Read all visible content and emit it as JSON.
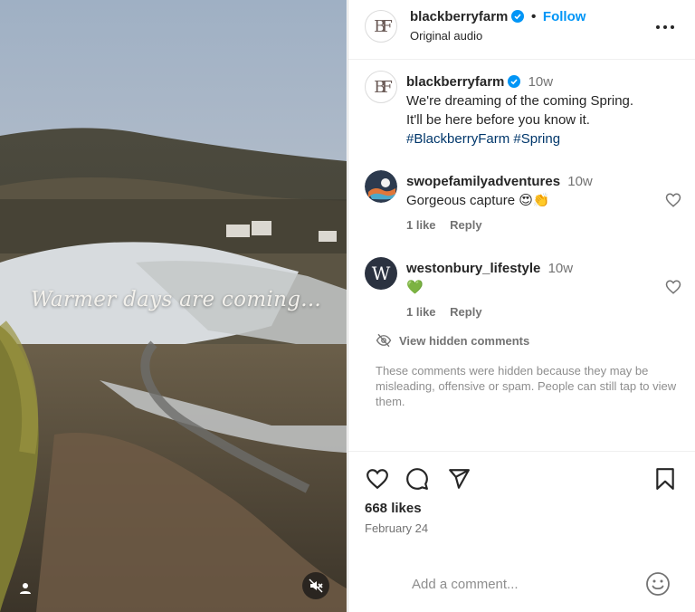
{
  "media": {
    "overlay_text": "Warmer days are coming...",
    "user_icon": "user-icon",
    "mute_icon": "speaker-muted-icon"
  },
  "post": {
    "username": "blackberryfarm",
    "verified_icon": "verified-badge-icon",
    "separator": "•",
    "follow_label": "Follow",
    "audio_label": "Original audio",
    "more_icon": "more-options-icon",
    "logo_monogram": "BF"
  },
  "caption": {
    "username": "blackberryfarm",
    "time": "10w",
    "line1": "We're dreaming of the coming Spring.",
    "line2": "It'll be here before you know it.",
    "hashtag1": "#BlackberryFarm",
    "hashtag2": "#Spring"
  },
  "comments": [
    {
      "username": "swopefamilyadventures",
      "time": "10w",
      "text": "Gorgeous capture 😍👏",
      "likes": "1 like",
      "reply": "Reply"
    },
    {
      "username": "westonbury_lifestyle",
      "time": "10w",
      "text": "💚",
      "likes": "1 like",
      "reply": "Reply",
      "avatar_letter": "W"
    }
  ],
  "hidden": {
    "link": "View hidden comments",
    "note": "These comments were hidden because they may be misleading, offensive or spam. People can still tap to view them."
  },
  "stats": {
    "likes": "668 likes",
    "date": "February 24"
  },
  "add_comment": {
    "placeholder": "Add a comment..."
  },
  "colors": {
    "accent": "#0095f6",
    "hashtag": "#00376b",
    "muted": "#737373"
  }
}
